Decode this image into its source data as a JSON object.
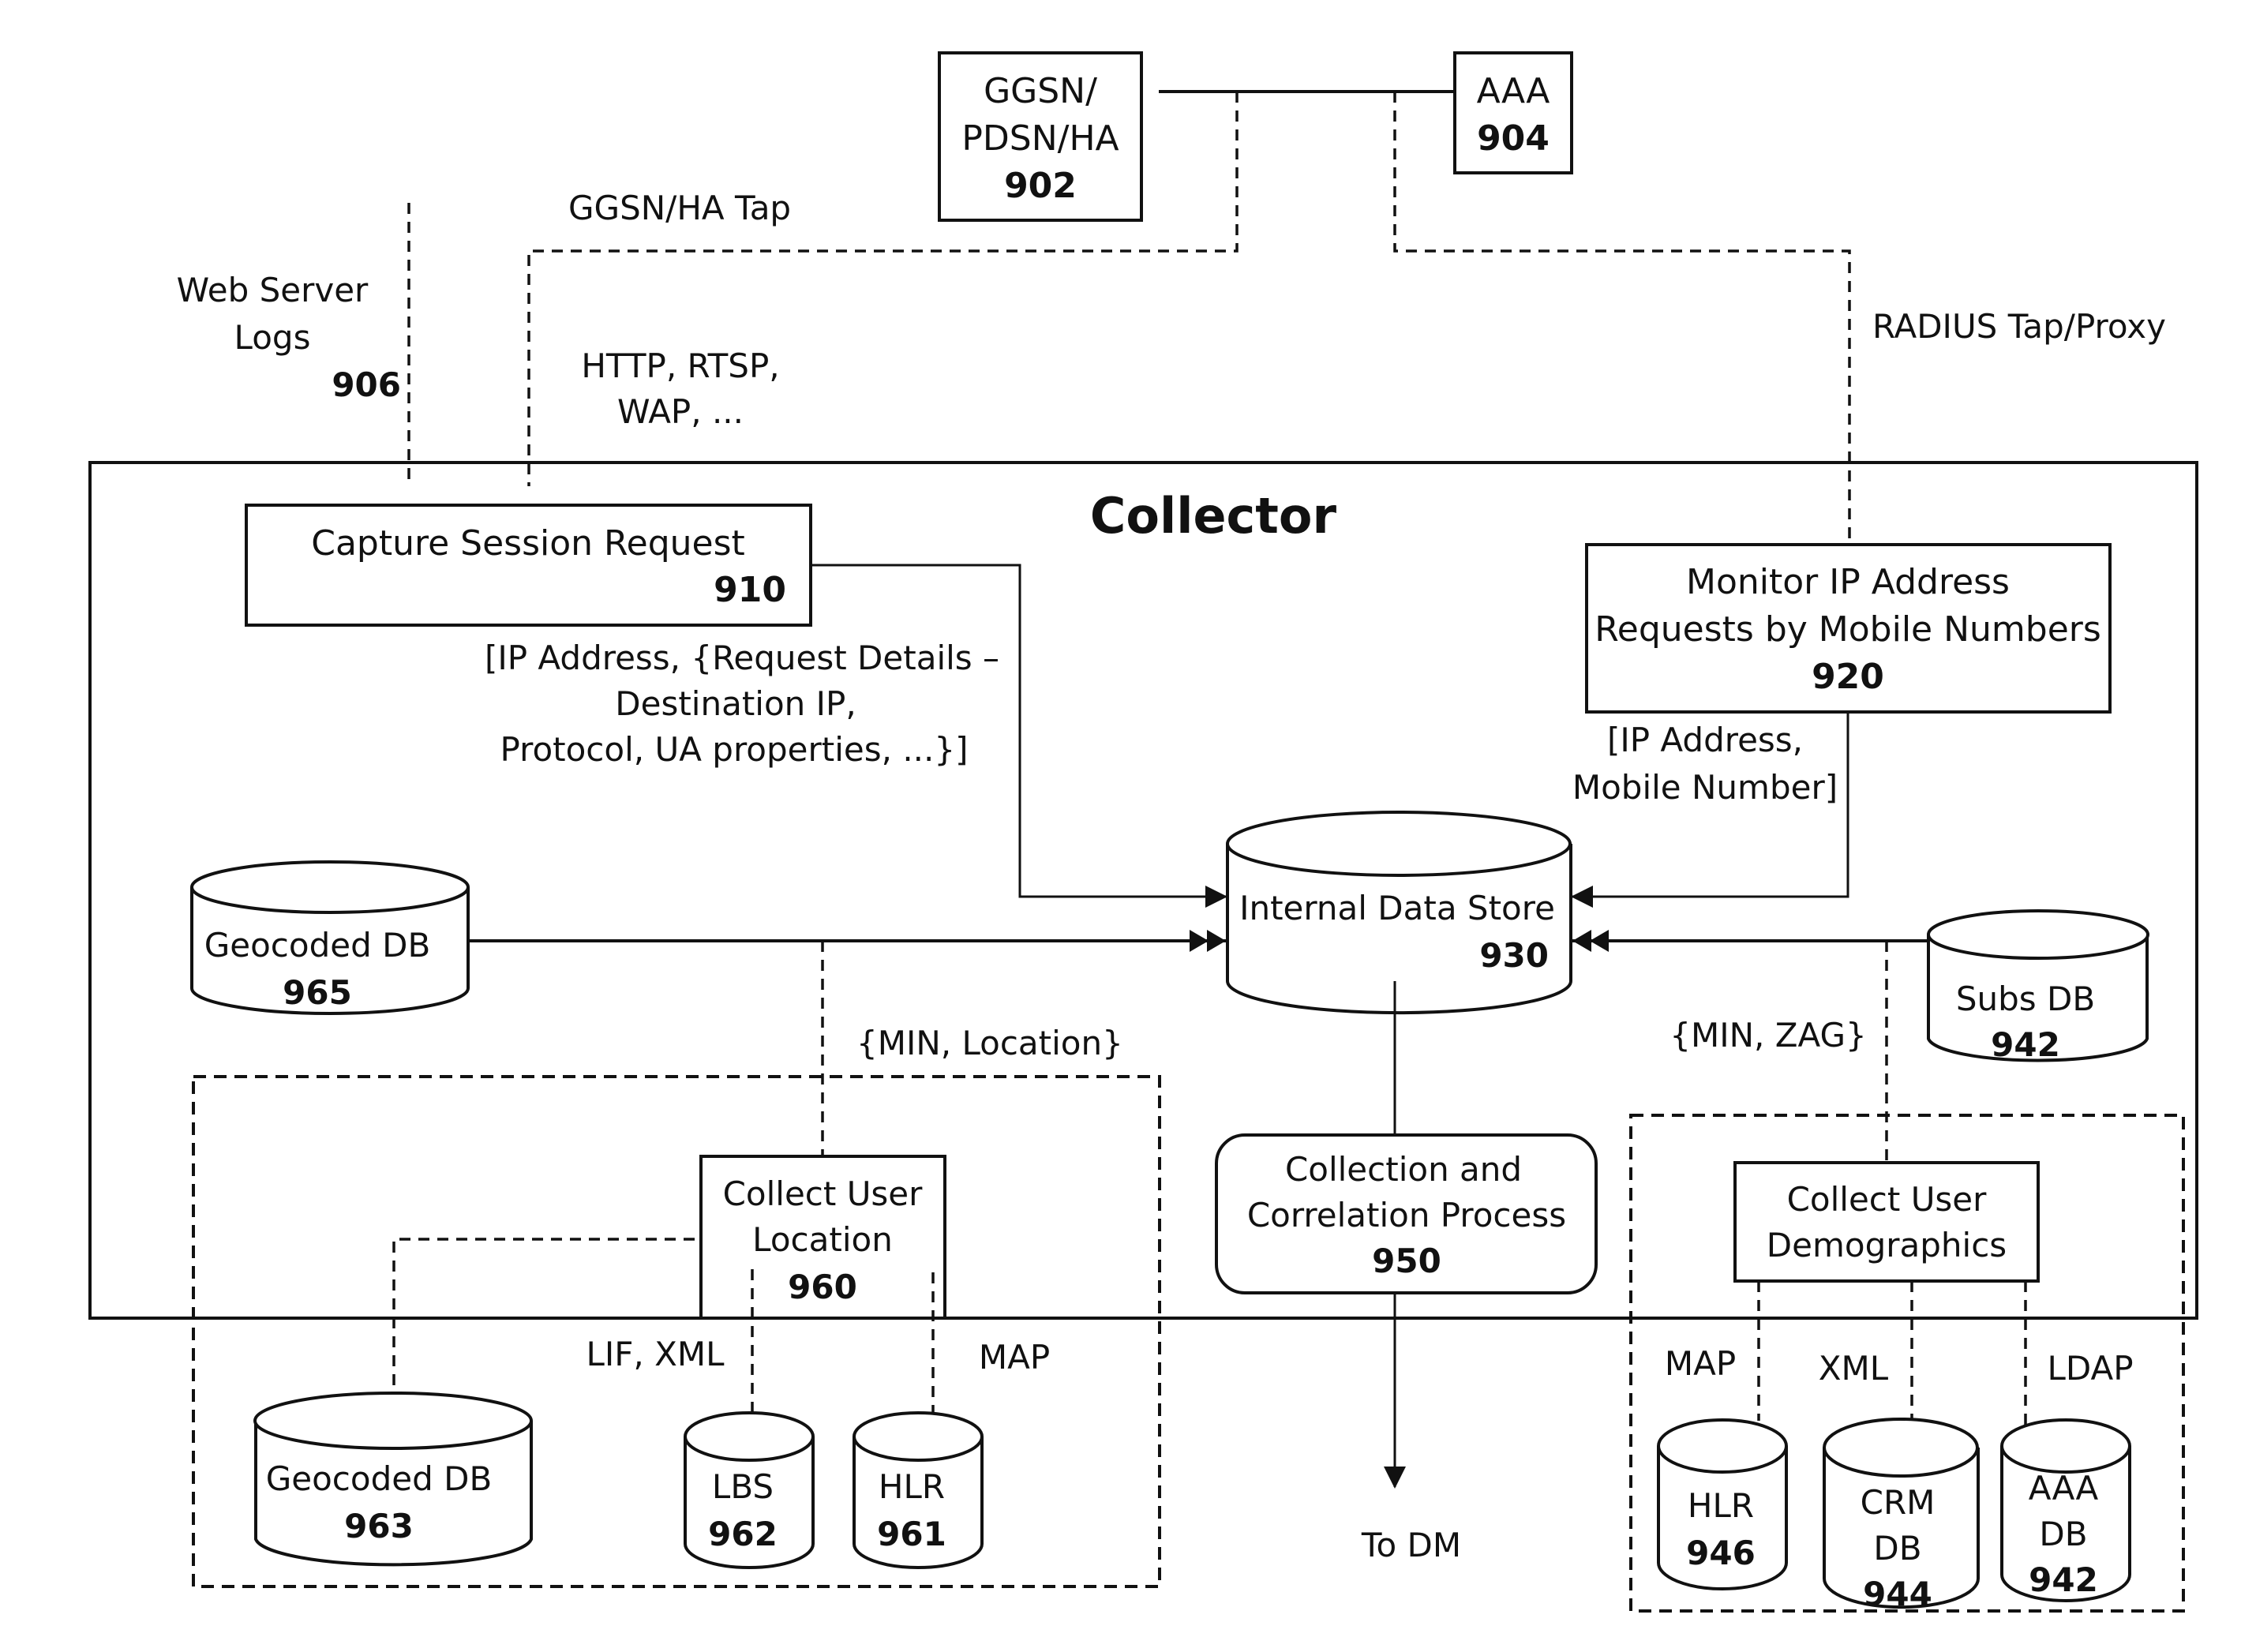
{
  "diagram": {
    "title": "Collector",
    "external_nodes": {
      "ggsn": {
        "line1": "GGSN/",
        "line2": "PDSN/HA",
        "ref": "902"
      },
      "aaa": {
        "line1": "AAA",
        "ref": "904"
      }
    },
    "external_labels": {
      "web_server_logs": {
        "line1": "Web Server",
        "line2": "Logs",
        "ref": "906"
      },
      "ggsn_tap": "GGSN/HA Tap",
      "protocols": {
        "line1": "HTTP, RTSP,",
        "line2": "WAP, ..."
      },
      "radius": "RADIUS Tap/Proxy"
    },
    "capture": {
      "label": "Capture Session Request",
      "ref": "910"
    },
    "capture_payload": {
      "line1": "[IP Address, {Request Details –",
      "line2": "Destination IP,",
      "line3": "Protocol, UA properties, ...}]"
    },
    "monitor": {
      "line1": "Monitor IP Address",
      "line2": "Requests by Mobile Numbers",
      "ref": "920"
    },
    "monitor_payload": {
      "line1": "[IP Address,",
      "line2": "Mobile Number]"
    },
    "internal_store": {
      "label": "Internal Data Store",
      "ref": "930"
    },
    "geocoded_965": {
      "label": "Geocoded DB",
      "ref": "965"
    },
    "subs_db": {
      "label": "Subs DB",
      "ref": "942"
    },
    "min_location": "{MIN, Location}",
    "min_zag": "{MIN, ZAG}",
    "process": {
      "line1": "Collection and",
      "line2": "Correlation Process",
      "ref": "950"
    },
    "to_dm": "To DM",
    "location": {
      "box": {
        "line1": "Collect User",
        "line2": "Location",
        "ref": "960"
      },
      "geocoded_963": {
        "label": "Geocoded DB",
        "ref": "963"
      },
      "lbs": {
        "label": "LBS",
        "ref": "962"
      },
      "hlr": {
        "label": "HLR",
        "ref": "961"
      },
      "lif_xml": "LIF, XML",
      "map": "MAP"
    },
    "demographics": {
      "box": {
        "line1": "Collect User",
        "line2": "Demographics"
      },
      "hlr": {
        "label": "HLR",
        "ref": "946"
      },
      "crm": {
        "line1": "CRM",
        "line2": "DB",
        "ref": "944"
      },
      "aaa_db": {
        "line1": "AAA",
        "line2": "DB",
        "ref": "942"
      },
      "map": "MAP",
      "xml": "XML",
      "ldap": "LDAP"
    }
  }
}
